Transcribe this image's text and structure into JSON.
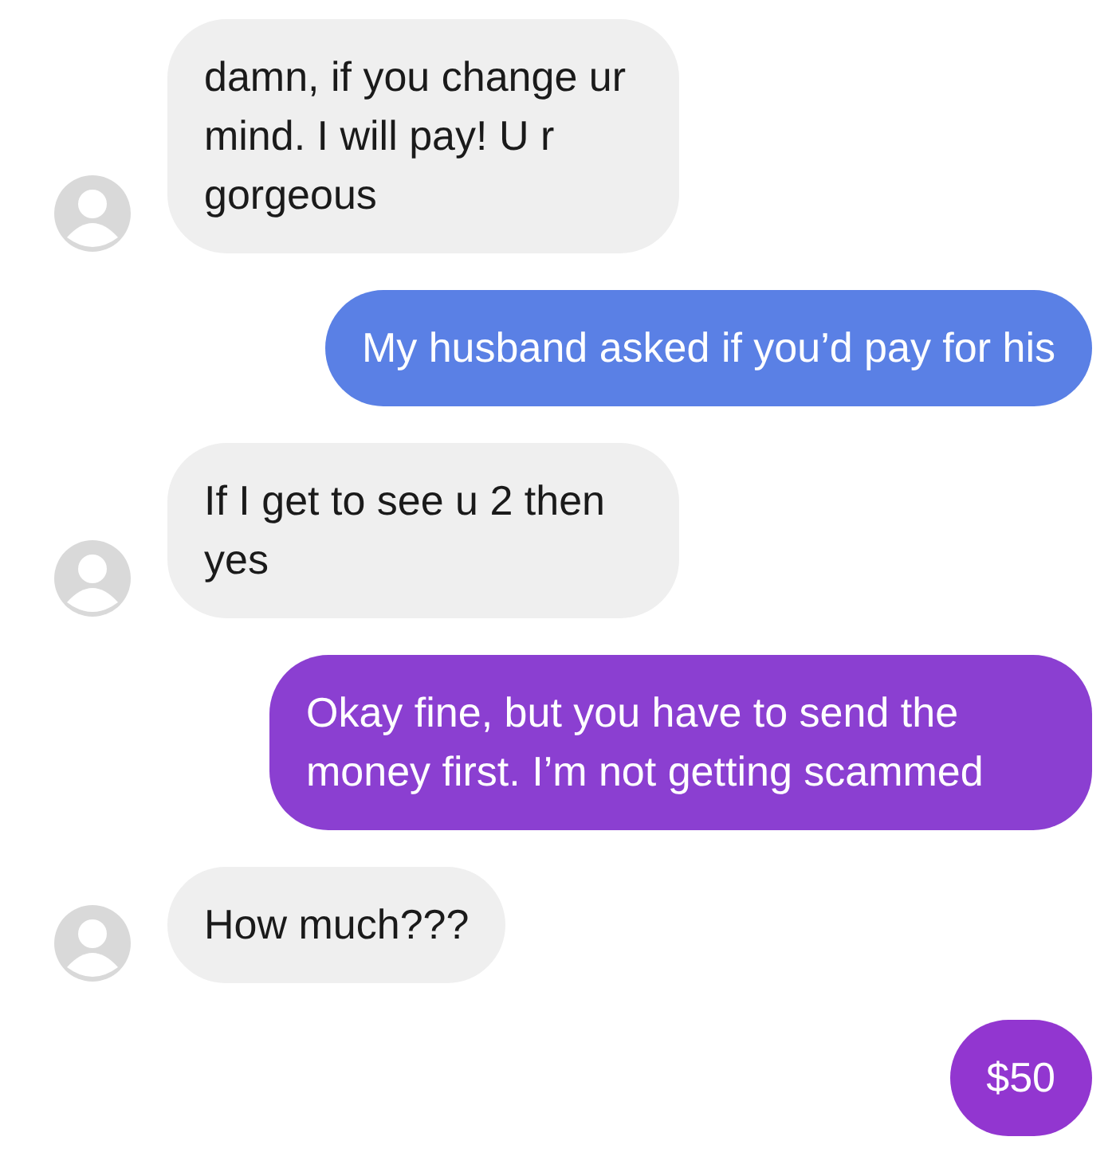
{
  "messages": [
    {
      "kind": "incoming",
      "text": "damn, if you change ur mind. I will pay! U r gorgeous",
      "color": "#efefef"
    },
    {
      "kind": "outgoing",
      "text": "My husband asked if you’d pay for his",
      "color": "#5a80e5"
    },
    {
      "kind": "incoming",
      "text": "If I get to see u 2 then yes",
      "color": "#efefef"
    },
    {
      "kind": "outgoing",
      "text": "Okay fine, but you have to send the money first. I’m not getting scammed",
      "color": "#8b3fd1"
    },
    {
      "kind": "incoming",
      "text": "How much???",
      "color": "#efefef"
    },
    {
      "kind": "outgoing",
      "text": "$50",
      "color": "#9236d0"
    }
  ]
}
